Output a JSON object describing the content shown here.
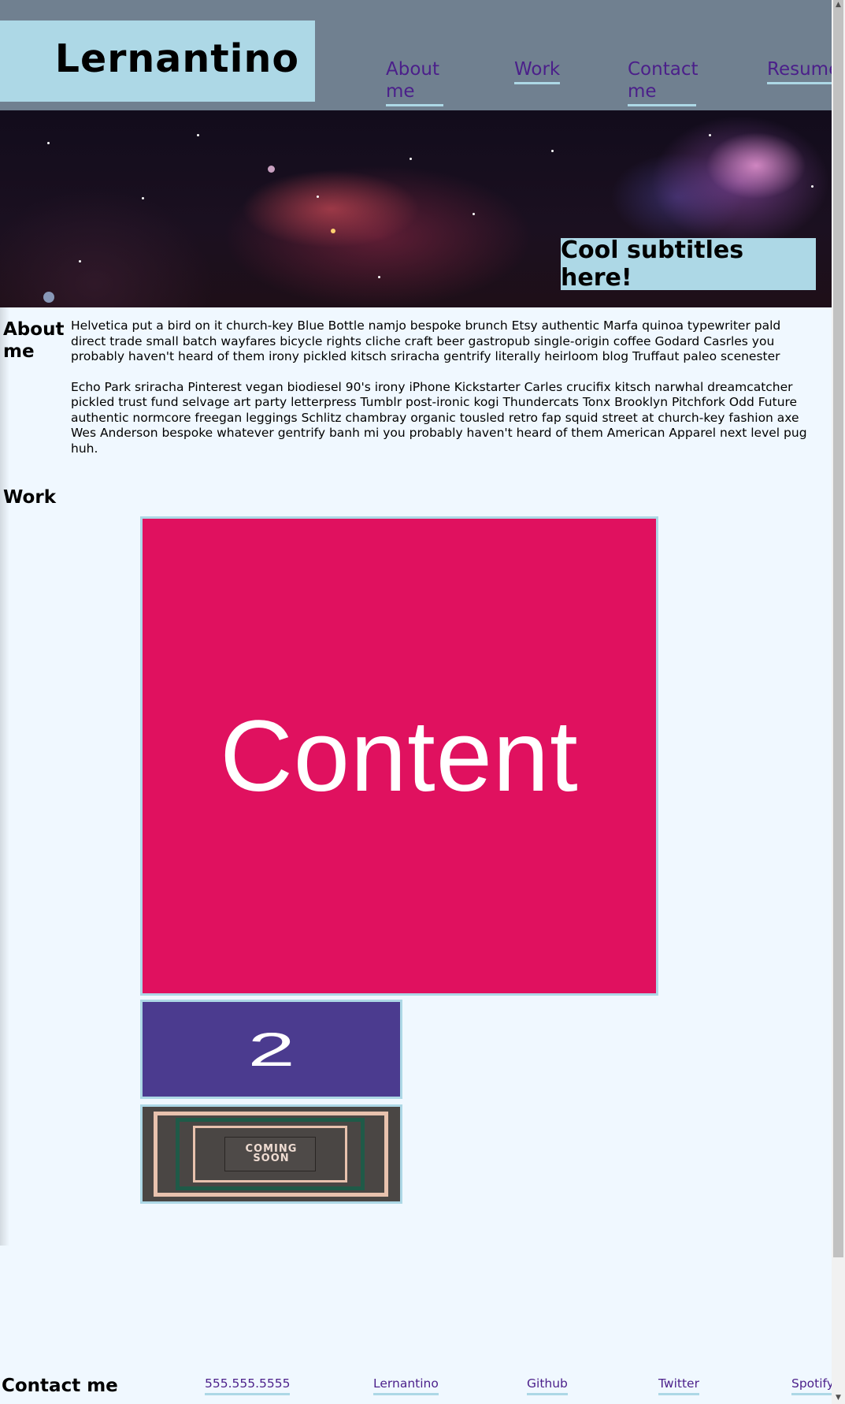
{
  "header": {
    "logo": "Lernantino",
    "nav": [
      {
        "label": "About me"
      },
      {
        "label": "Work"
      },
      {
        "label": "Contact me"
      },
      {
        "label": "Resume"
      }
    ]
  },
  "banner": {
    "subtitle": "Cool subtitles here!"
  },
  "about": {
    "heading": "About me",
    "paragraphs": [
      "Helvetica put a bird on it church-key Blue Bottle namjo bespoke brunch Etsy authentic Marfa quinoa typewriter pald direct trade small batch wayfares bicycle rights cliche craft beer gastropub single-origin coffee Godard Casrles you probably haven't heard of them irony pickled kitsch sriracha gentrify literally heirloom blog Truffaut paleo scenester",
      "Echo Park sriracha Pinterest vegan biodiesel 90's irony iPhone Kickstarter Carles crucifix kitsch narwhal dreamcatcher pickled trust fund selvage art party letterpress Tumblr post-ironic kogi Thundercats Tonx Brooklyn Pitchfork Odd Future authentic normcore freegan leggings Schlitz chambray organic tousled retro fap squid street at church-key fashion axe Wes Anderson bespoke whatever gentrify banh mi you probably haven't heard of them American Apparel next level pug huh."
    ]
  },
  "work": {
    "heading": "Work",
    "tiles": [
      {
        "text": "Content",
        "color": "#e0115f"
      },
      {
        "text": "2",
        "color": "#4b3b8f"
      },
      {
        "text_line1": "COMING",
        "text_line2": "SOON",
        "color": "#4a4644"
      }
    ]
  },
  "contact": {
    "heading": "Contact me",
    "links": [
      "555.555.5555",
      "Lernantino",
      "Github",
      "Twitter",
      "Spotify"
    ]
  },
  "colors": {
    "header_bg": "#708090",
    "accent": "#add8e6",
    "link": "#4b1f8a",
    "page_bg": "#f0f8ff"
  }
}
